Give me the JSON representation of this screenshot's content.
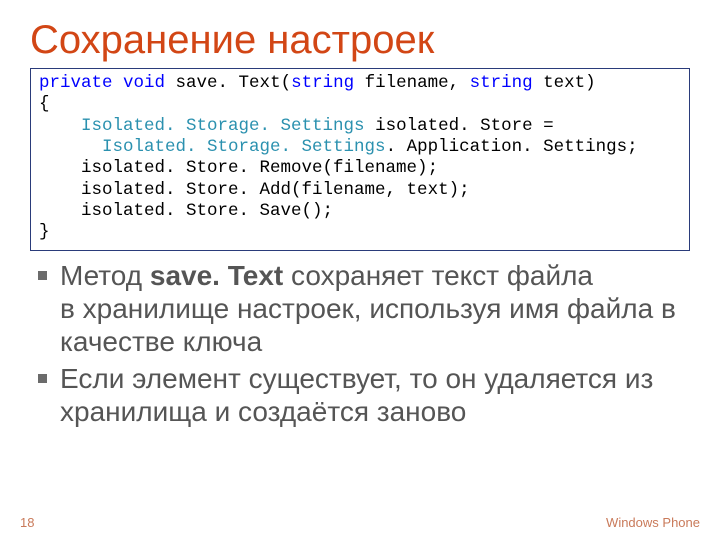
{
  "title": "Сохранение настроек",
  "code": {
    "line1": {
      "kw1": "private",
      "kw2": "void",
      "fn": " save. Text(",
      "tp1": "string",
      "a1": " filename, ",
      "tp2": "string",
      "a2": " text)"
    },
    "line2": "{",
    "line3": {
      "indent": "    ",
      "tp": "Isolated. Storage. Settings",
      "rest": " isolated. Store ="
    },
    "line4": {
      "indent": "      ",
      "tp": "Isolated. Storage. Settings",
      "rest": ". Application. Settings;"
    },
    "line5": "    isolated. Store. Remove(filename);",
    "line6": "    isolated. Store. Add(filename, text);",
    "line7": "    isolated. Store. Save();",
    "line8": "}"
  },
  "bullets": {
    "b1_a": "Метод ",
    "b1_strong": "save. Text",
    "b1_b": " сохраняет текст файла в хранилище настроек, используя имя файла в качестве ключа",
    "b2": "Если элемент существует, то он удаляется из хранилища и создаётся заново"
  },
  "pagenum": "18",
  "brand": "Windows Phone"
}
